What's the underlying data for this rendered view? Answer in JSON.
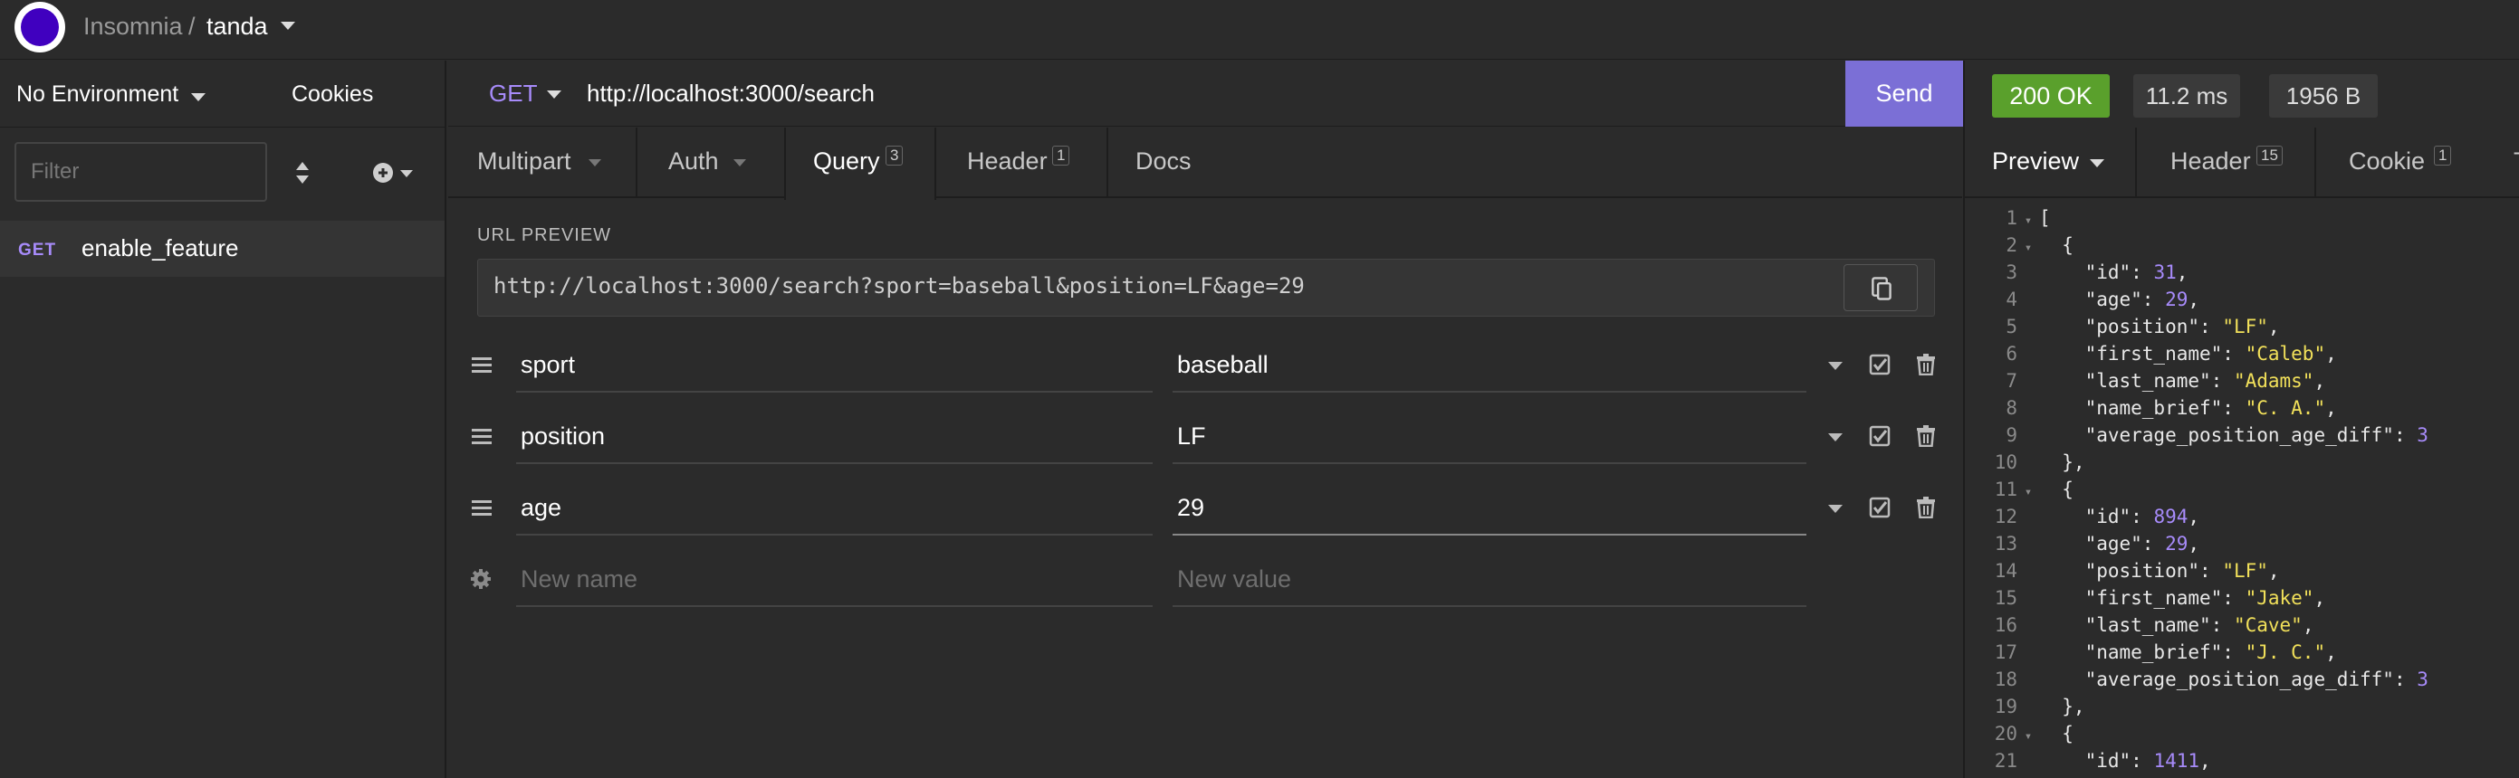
{
  "app": {
    "name": "Insomnia",
    "separator": "/",
    "workspace": "tanda"
  },
  "sidebar": {
    "environment": "No Environment",
    "cookies": "Cookies",
    "filter_placeholder": "Filter",
    "requests": [
      {
        "method": "GET",
        "name": "enable_feature"
      }
    ]
  },
  "request": {
    "method": "GET",
    "url": "http://localhost:3000/search",
    "send_label": "Send"
  },
  "tabs": {
    "multipart": "Multipart",
    "auth": "Auth",
    "query": "Query",
    "query_count": "3",
    "header": "Header",
    "header_count": "1",
    "docs": "Docs"
  },
  "url_preview": {
    "label": "URL PREVIEW",
    "value": "http://localhost:3000/search?sport=baseball&position=LF&age=29"
  },
  "params": [
    {
      "name": "sport",
      "value": "baseball"
    },
    {
      "name": "position",
      "value": "LF"
    },
    {
      "name": "age",
      "value": "29"
    }
  ],
  "new_param": {
    "name_placeholder": "New name",
    "value_placeholder": "New value"
  },
  "response": {
    "status": "200 OK",
    "time": "11.2 ms",
    "size": "1956 B",
    "tabs": {
      "preview": "Preview",
      "header": "Header",
      "header_count": "15",
      "cookie": "Cookie",
      "cookie_count": "1"
    },
    "lines": [
      {
        "n": "1",
        "fold": true,
        "text": "["
      },
      {
        "n": "2",
        "fold": true,
        "text": "  {"
      },
      {
        "n": "3",
        "key": "\"id\"",
        "val": "31",
        "t": "n",
        "end": ","
      },
      {
        "n": "4",
        "key": "\"age\"",
        "val": "29",
        "t": "n",
        "end": ","
      },
      {
        "n": "5",
        "key": "\"position\"",
        "val": "\"LF\"",
        "t": "s",
        "end": ","
      },
      {
        "n": "6",
        "key": "\"first_name\"",
        "val": "\"Caleb\"",
        "t": "s",
        "end": ","
      },
      {
        "n": "7",
        "key": "\"last_name\"",
        "val": "\"Adams\"",
        "t": "s",
        "end": ","
      },
      {
        "n": "8",
        "key": "\"name_brief\"",
        "val": "\"C. A.\"",
        "t": "s",
        "end": ","
      },
      {
        "n": "9",
        "key": "\"average_position_age_diff\"",
        "val": "3",
        "t": "n",
        "end": ""
      },
      {
        "n": "10",
        "text": "  },"
      },
      {
        "n": "11",
        "fold": true,
        "text": "  {"
      },
      {
        "n": "12",
        "key": "\"id\"",
        "val": "894",
        "t": "n",
        "end": ","
      },
      {
        "n": "13",
        "key": "\"age\"",
        "val": "29",
        "t": "n",
        "end": ","
      },
      {
        "n": "14",
        "key": "\"position\"",
        "val": "\"LF\"",
        "t": "s",
        "end": ","
      },
      {
        "n": "15",
        "key": "\"first_name\"",
        "val": "\"Jake\"",
        "t": "s",
        "end": ","
      },
      {
        "n": "16",
        "key": "\"last_name\"",
        "val": "\"Cave\"",
        "t": "s",
        "end": ","
      },
      {
        "n": "17",
        "key": "\"name_brief\"",
        "val": "\"J. C.\"",
        "t": "s",
        "end": ","
      },
      {
        "n": "18",
        "key": "\"average_position_age_diff\"",
        "val": "3",
        "t": "n",
        "end": ""
      },
      {
        "n": "19",
        "text": "  },"
      },
      {
        "n": "20",
        "fold": true,
        "text": "  {"
      },
      {
        "n": "21",
        "key": "\"id\"",
        "val": "1411",
        "t": "n",
        "end": ","
      }
    ]
  },
  "colors": {
    "accent": "#7b6fd6",
    "method": "#a78bfa",
    "status_ok": "#5aa02c",
    "json_string": "#f1e05a",
    "json_number": "#a78bfa"
  },
  "icons": [
    "logo-icon",
    "caret-down-icon",
    "sort-icon",
    "add-circle-icon",
    "copy-icon",
    "drag-handle-icon",
    "checkbox-icon",
    "trash-icon",
    "gear-icon"
  ]
}
